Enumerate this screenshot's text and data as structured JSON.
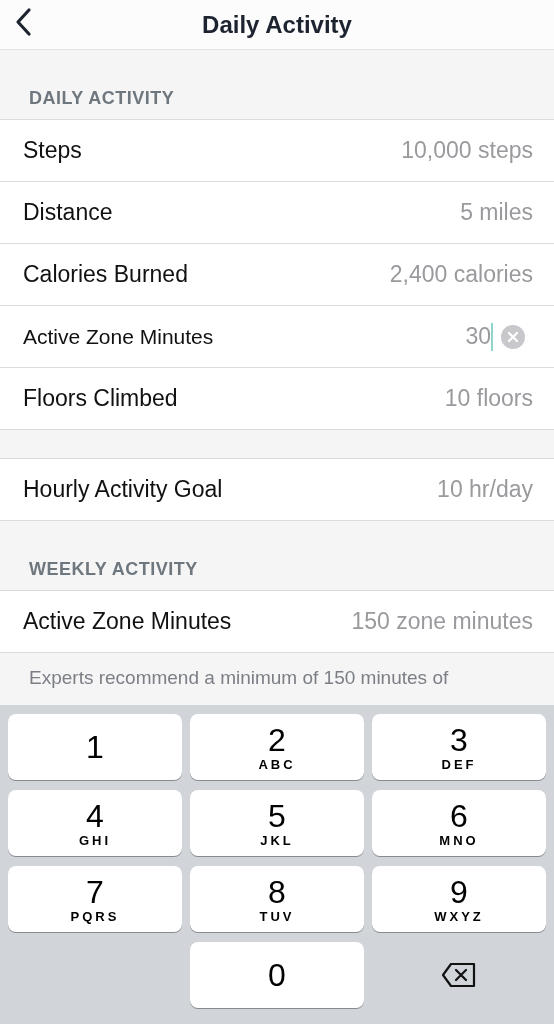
{
  "header": {
    "title": "Daily Activity"
  },
  "sections": [
    {
      "heading": "DAILY ACTIVITY",
      "rows": [
        {
          "label": "Steps",
          "value": "10,000 steps",
          "editing": false
        },
        {
          "label": "Distance",
          "value": "5 miles",
          "editing": false
        },
        {
          "label": "Calories Burned",
          "value": "2,400 calories",
          "editing": false
        },
        {
          "label": "Active Zone Minutes",
          "value": "30",
          "editing": true
        },
        {
          "label": "Floors Climbed",
          "value": "10 floors",
          "editing": false
        }
      ]
    },
    {
      "rows": [
        {
          "label": "Hourly Activity Goal",
          "value": "10 hr/day",
          "editing": false
        }
      ]
    },
    {
      "heading": "WEEKLY ACTIVITY",
      "rows": [
        {
          "label": "Active Zone Minutes",
          "value": "150 zone minutes",
          "editing": false
        }
      ],
      "footer": "Experts recommend a minimum of 150 minutes of"
    }
  ],
  "keyboard": [
    {
      "kind": "digit",
      "digit": "1"
    },
    {
      "kind": "digit",
      "digit": "2",
      "letters": "ABC"
    },
    {
      "kind": "digit",
      "digit": "3",
      "letters": "DEF"
    },
    {
      "kind": "digit",
      "digit": "4",
      "letters": "GHI"
    },
    {
      "kind": "digit",
      "digit": "5",
      "letters": "JKL"
    },
    {
      "kind": "digit",
      "digit": "6",
      "letters": "MNO"
    },
    {
      "kind": "digit",
      "digit": "7",
      "letters": "PQRS"
    },
    {
      "kind": "digit",
      "digit": "8",
      "letters": "TUV"
    },
    {
      "kind": "digit",
      "digit": "9",
      "letters": "WXYZ"
    },
    {
      "kind": "blank"
    },
    {
      "kind": "digit",
      "digit": "0"
    },
    {
      "kind": "delete"
    }
  ]
}
